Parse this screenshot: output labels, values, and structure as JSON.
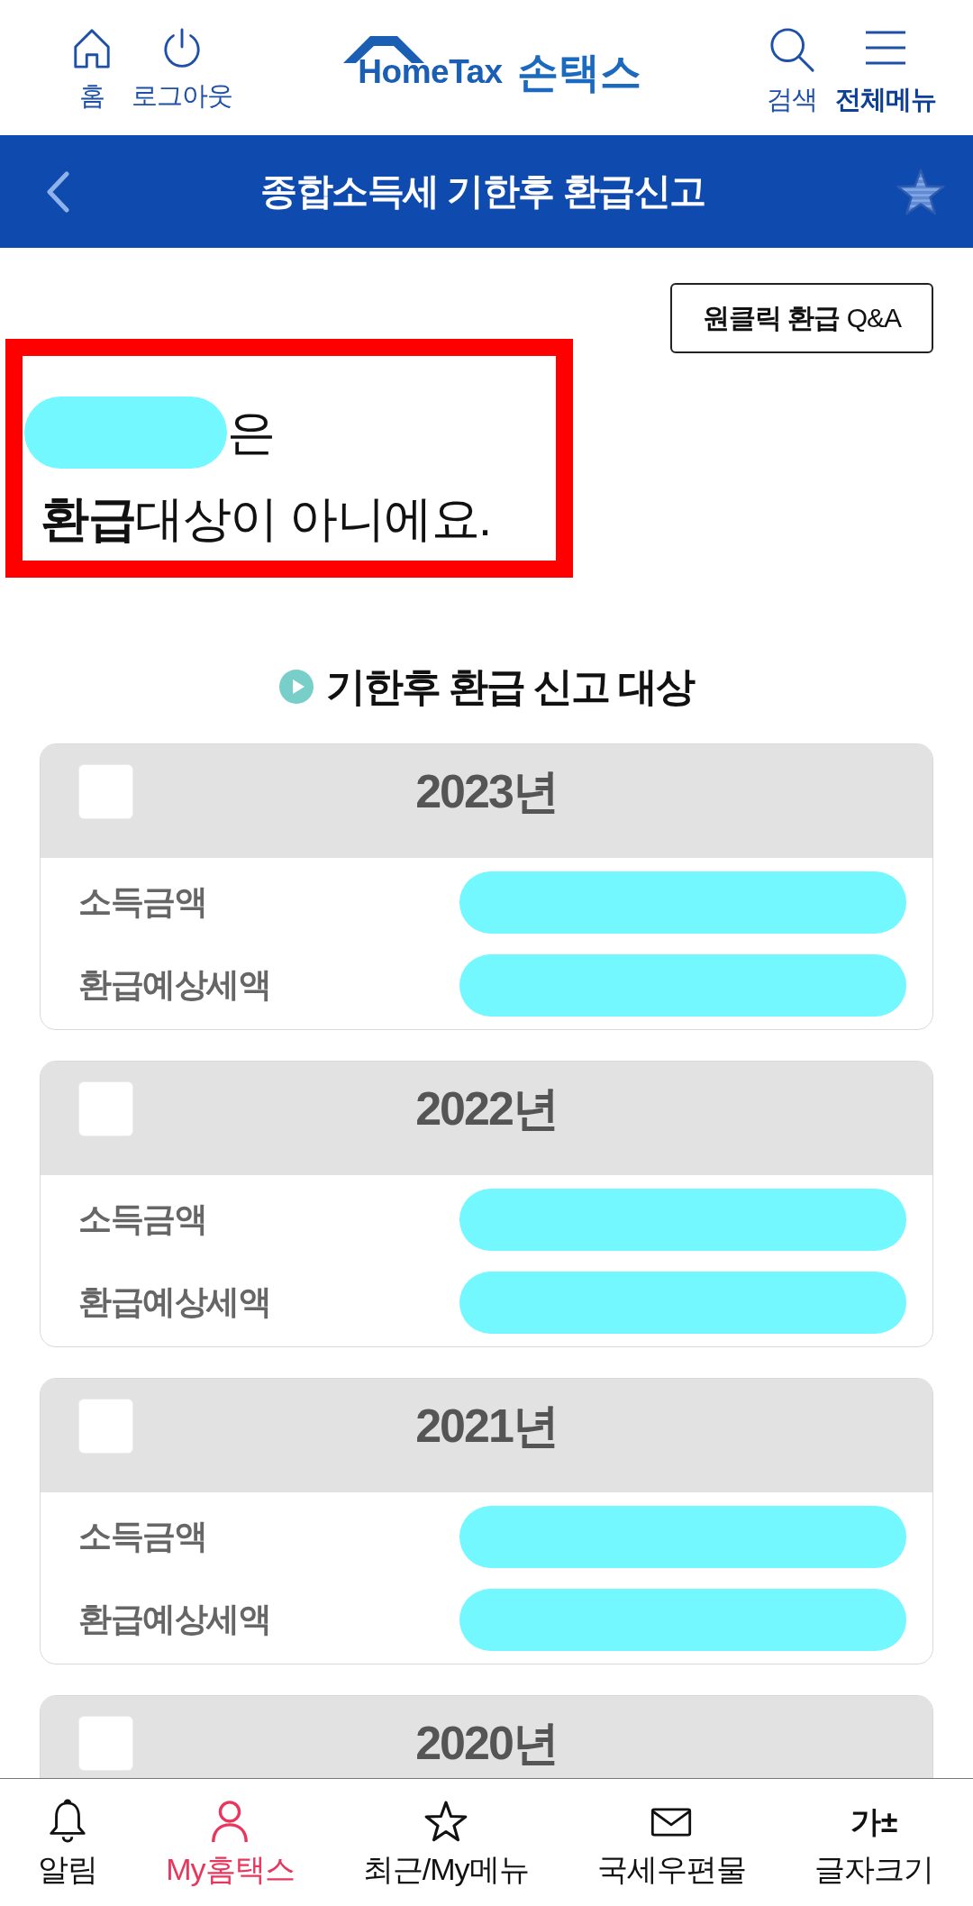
{
  "header": {
    "left_buttons": [
      {
        "label": "홈"
      },
      {
        "label": "로그아웃"
      }
    ],
    "logo": {
      "wordmark": "HomeTax",
      "name": "손택스"
    },
    "right_buttons": [
      {
        "label": "검색",
        "bold": false
      },
      {
        "label": "전체메뉴",
        "bold": true
      }
    ]
  },
  "title_bar": {
    "title": "종합소득세 기한후 환급신고"
  },
  "qa_button": "**원클릭 환급** Q&A",
  "result": {
    "highlighted": true,
    "name_redacted": true,
    "line1": "은",
    "line2": "**환급**대상이 아니에요."
  },
  "section_title": "기한후 환급 신고 대상",
  "years": [
    {
      "year": "2023년",
      "checked": false,
      "rows": [
        {
          "label": "소득금액",
          "redacted": true
        },
        {
          "label": "환급예상세액",
          "redacted": true
        }
      ]
    },
    {
      "year": "2022년",
      "checked": false,
      "rows": [
        {
          "label": "소득금액",
          "redacted": true
        },
        {
          "label": "환급예상세액",
          "redacted": true
        }
      ]
    },
    {
      "year": "2021년",
      "checked": false,
      "rows": [
        {
          "label": "소득금액",
          "redacted": true
        },
        {
          "label": "환급예상세액",
          "redacted": true
        }
      ]
    },
    {
      "year": "2020년",
      "checked": false
    }
  ],
  "bottom_nav": [
    {
      "label": "알림",
      "selected": false
    },
    {
      "label": "My홈택스",
      "selected": true
    },
    {
      "label": "최근/My메뉴",
      "selected": false
    },
    {
      "label": "국세우편물",
      "selected": false
    },
    {
      "label": "글자크기",
      "selected": false,
      "icon_text": "가±"
    }
  ]
}
